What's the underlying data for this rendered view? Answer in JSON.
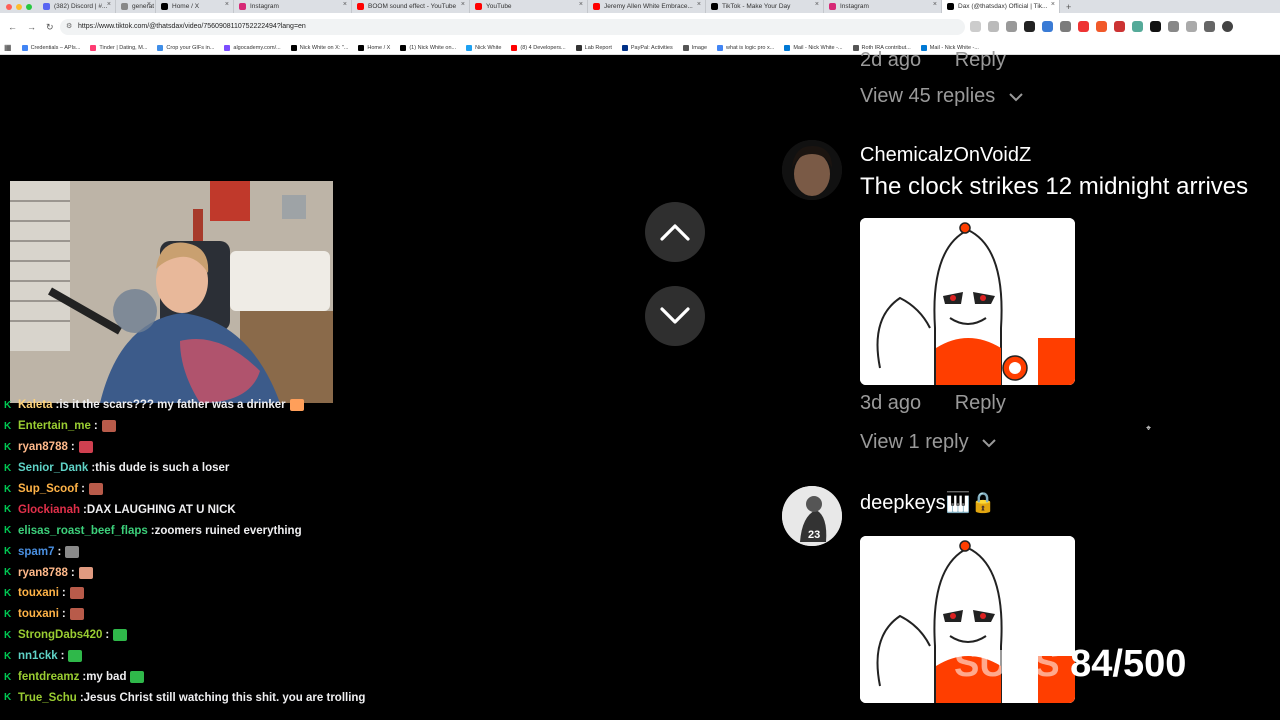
{
  "browser": {
    "tabs": [
      {
        "label": "(382) Discord | #...",
        "color": "#5865f2"
      },
      {
        "label": "generat",
        "color": "#888888"
      },
      {
        "label": "Home / X",
        "color": "#000000"
      },
      {
        "label": "Instagram",
        "color": "#d62976"
      },
      {
        "label": "BOOM sound effect - YouTube",
        "color": "#ff0000"
      },
      {
        "label": "YouTube",
        "color": "#ff0000"
      },
      {
        "label": "Jeremy Allen White Embrace...",
        "color": "#ff0000"
      },
      {
        "label": "TikTok - Make Your Day",
        "color": "#000000"
      },
      {
        "label": "Instagram",
        "color": "#d62976"
      },
      {
        "label": "Dax (@thatsdax) Official | Tik...",
        "color": "#000000",
        "active": true
      }
    ],
    "url": "https://www.tiktok.com/@thatsdax/video/7560908110752222494?lang=en",
    "bookmarks": [
      {
        "label": "Credentials – APIs...",
        "color": "#4285f4"
      },
      {
        "label": "Tinder | Dating, M...",
        "color": "#fe3c72"
      },
      {
        "label": "Crop your GIFs in...",
        "color": "#3f8ee8"
      },
      {
        "label": "algocademy.com/...",
        "color": "#7c4dff"
      },
      {
        "label": "Nick White on X: \"...",
        "color": "#000000"
      },
      {
        "label": "Home / X",
        "color": "#000000"
      },
      {
        "label": "(1) Nick White on...",
        "color": "#000000"
      },
      {
        "label": "Nick White",
        "color": "#1da1f2"
      },
      {
        "label": "(8) 4 Developers...",
        "color": "#ff0000"
      },
      {
        "label": "Lab Report",
        "color": "#333333"
      },
      {
        "label": "PayPal: Activities",
        "color": "#003087"
      },
      {
        "label": "Image",
        "color": "#555555"
      },
      {
        "label": "what is logic pro x...",
        "color": "#4285f4"
      },
      {
        "label": "Mail - Nick White -...",
        "color": "#0078d4"
      },
      {
        "label": "Roth IRA contribut...",
        "color": "#555555"
      },
      {
        "label": "Mail - Nick White -...",
        "color": "#0078d4"
      }
    ]
  },
  "chat": {
    "messages": [
      {
        "user": "Kaleta",
        "user_color": "#ffd37a",
        "text": "is it the scars??? my father was a drinker",
        "emote": "#ff9f5a"
      },
      {
        "user": "Entertain_me",
        "user_color": "#9acd32",
        "text": "",
        "emote": "#b85b4a"
      },
      {
        "user": "ryan8788",
        "user_color": "#ffb98a",
        "text": "",
        "emote": "#d04050"
      },
      {
        "user": "Senior_Dank",
        "user_color": "#5fd3c7",
        "text": "this dude is such a loser",
        "emote": ""
      },
      {
        "user": "Sup_Scoof",
        "user_color": "#ffb347",
        "text": "",
        "emote": "#b85b4a"
      },
      {
        "user": "Glockianah",
        "user_color": "#e0304a",
        "text": "DAX LAUGHING AT U NICK",
        "emote": ""
      },
      {
        "user": "elisas_roast_beef_flaps",
        "user_color": "#3ccf7a",
        "text": "zoomers ruined everything",
        "emote": ""
      },
      {
        "user": "spam7",
        "user_color": "#4a90e2",
        "text": "",
        "emote": "#8a8a8a"
      },
      {
        "user": "ryan8788",
        "user_color": "#ffb98a",
        "text": "",
        "emote": "#e09a80"
      },
      {
        "user": "touxani",
        "user_color": "#ffb347",
        "text": "",
        "emote": "#b85b4a"
      },
      {
        "user": "touxani",
        "user_color": "#ffb347",
        "text": "",
        "emote": "#b85b4a"
      },
      {
        "user": "StrongDabs420",
        "user_color": "#9acd32",
        "text": "",
        "emote": "#2fb84a"
      },
      {
        "user": "nn1ckk",
        "user_color": "#5fd3c7",
        "text": "",
        "emote": "#2fb84a"
      },
      {
        "user": "fentdreamz",
        "user_color": "#9acd32",
        "text": "my bad",
        "emote": "#2fb84a"
      },
      {
        "user": "True_Schu",
        "user_color": "#9acd32",
        "text": "Jesus Christ still watching this shit. you are trolling",
        "emote": ""
      }
    ]
  },
  "comments": {
    "top_meta": {
      "age": "2d ago",
      "reply": "Reply"
    },
    "view_replies_1": "View 45 replies",
    "comment1": {
      "user": "ChemicalzOnVoidZ",
      "text": "The clock strikes 12 midnight arrives",
      "age": "3d ago",
      "reply": "Reply",
      "view_replies": "View 1 reply"
    },
    "comment2": {
      "user": "deepkeys🎹🔒"
    }
  },
  "overlay": {
    "subs_label": "SUBS",
    "subs_count": "84/500"
  }
}
